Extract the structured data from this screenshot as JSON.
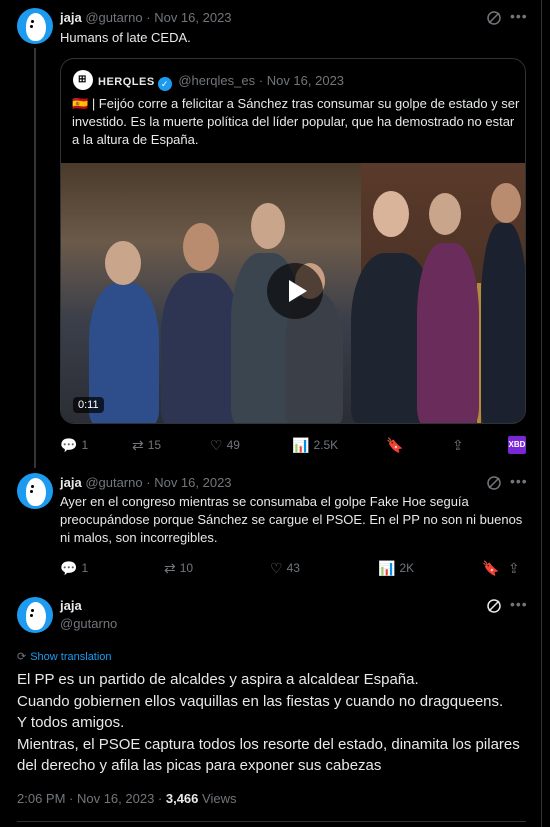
{
  "colors": {
    "accent": "#1d9bf0",
    "background": "#000000",
    "muted": "#71767b",
    "text": "#e7e9ea",
    "bookmark": "#1d9bf0"
  },
  "tweet1": {
    "name": "jaja",
    "handle": "@gutarno",
    "date": "Nov 16, 2023",
    "text": "Humans of late CEDA.",
    "quote": {
      "name": "HERQLES",
      "handle": "@herqles_es",
      "date": "Nov 16, 2023",
      "flag": "🇪🇸",
      "text": "| Feijóo corre a felicitar a Sánchez tras consumar su golpe de estado y ser investido. Es la muerte política del líder popular, que ha demostrado no estar a la altura de España.",
      "video_duration": "0:11"
    },
    "actions": {
      "replies": "1",
      "reposts": "15",
      "likes": "49",
      "views": "2.5K",
      "extension_badge": "XBD"
    }
  },
  "tweet2": {
    "name": "jaja",
    "handle": "@gutarno",
    "date": "Nov 16, 2023",
    "text": "Ayer en  el congreso mientras se consumaba el golpe Fake Hoe seguía preocupándose porque Sánchez se cargue el PSOE. En el PP no son ni buenos ni malos, son incorregibles.",
    "actions": {
      "replies": "1",
      "reposts": "10",
      "likes": "43",
      "views": "2K"
    }
  },
  "main": {
    "name": "jaja",
    "handle": "@gutarno",
    "show_translation": "Show translation",
    "text_lines": [
      "El PP es un partido de alcaldes y aspira a alcaldear España.",
      "Cuando gobiernen ellos vaquillas en las fiestas y cuando no dragqueens.",
      "Y todos amigos.",
      "Mientras, el PSOE captura todos los resorte del estado, dinamita los pilares del derecho y afila las picas para exponer sus cabezas"
    ],
    "time": "2:06 PM · Nov 16, 2023 · ",
    "views_count": "3,466",
    "views_label": " Views"
  }
}
